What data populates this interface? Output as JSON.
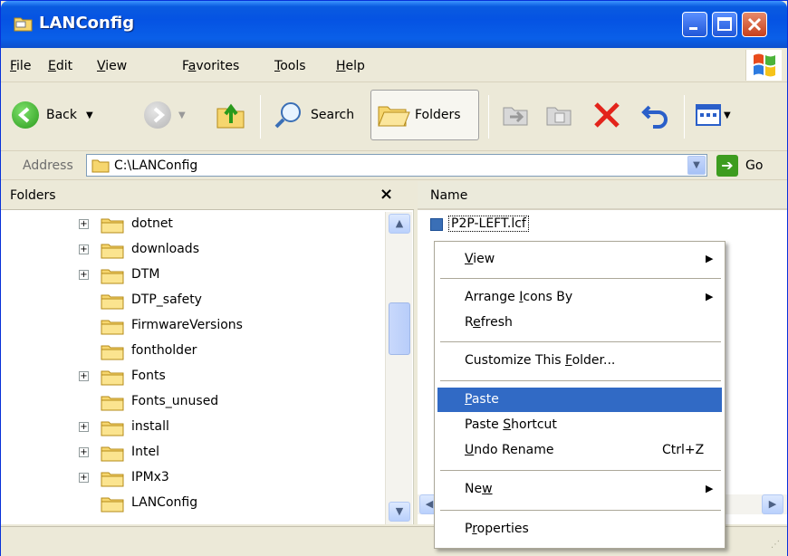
{
  "window": {
    "title": "LANConfig",
    "colors": {
      "titlebar": "#0553e3",
      "menu_highlight": "#316ac5"
    }
  },
  "menubar": {
    "items": [
      {
        "pre": "",
        "key": "F",
        "post": "ile"
      },
      {
        "pre": "",
        "key": "E",
        "post": "dit"
      },
      {
        "pre": "",
        "key": "V",
        "post": "iew"
      },
      {
        "pre": "F",
        "key": "a",
        "post": "vorites"
      },
      {
        "pre": "",
        "key": "T",
        "post": "ools"
      },
      {
        "pre": "",
        "key": "H",
        "post": "elp"
      }
    ]
  },
  "toolbar": {
    "back_label": "Back",
    "search_label": "Search",
    "folders_label": "Folders",
    "icons": [
      "back-icon",
      "forward-icon",
      "up-folder-icon",
      "search-icon",
      "folders-icon",
      "move-to-icon",
      "copy-to-icon",
      "delete-icon",
      "undo-icon",
      "views-icon"
    ]
  },
  "address": {
    "label": "Address",
    "path": "C:\\LANConfig",
    "go_label": "Go"
  },
  "folders": {
    "title": "Folders",
    "close": "×",
    "items": [
      {
        "name": "dotnet",
        "expandable": true
      },
      {
        "name": "downloads",
        "expandable": true
      },
      {
        "name": "DTM",
        "expandable": true
      },
      {
        "name": "DTP_safety",
        "expandable": false
      },
      {
        "name": "FirmwareVersions",
        "expandable": false
      },
      {
        "name": "fontholder",
        "expandable": false
      },
      {
        "name": "Fonts",
        "expandable": true
      },
      {
        "name": "Fonts_unused",
        "expandable": false
      },
      {
        "name": "install",
        "expandable": true
      },
      {
        "name": "Intel",
        "expandable": true
      },
      {
        "name": "IPMx3",
        "expandable": true
      },
      {
        "name": "LANConfig",
        "expandable": false
      }
    ]
  },
  "files": {
    "column_name": "Name",
    "items": [
      {
        "name": "P2P-LEFT.lcf"
      }
    ]
  },
  "context_menu": {
    "items": [
      {
        "pre": "",
        "key": "V",
        "post": "iew",
        "submenu": true,
        "shortcut": ""
      },
      {
        "pre": "Arrange ",
        "key": "I",
        "post": "cons By",
        "submenu": true,
        "shortcut": ""
      },
      {
        "pre": "R",
        "key": "e",
        "post": "fresh",
        "submenu": false,
        "shortcut": ""
      },
      {
        "pre": "Customize This ",
        "key": "F",
        "post": "older...",
        "submenu": false,
        "shortcut": ""
      },
      {
        "pre": "",
        "key": "P",
        "post": "aste",
        "submenu": false,
        "shortcut": "",
        "highlighted": true
      },
      {
        "pre": "Paste ",
        "key": "S",
        "post": "hortcut",
        "submenu": false,
        "shortcut": ""
      },
      {
        "pre": "",
        "key": "U",
        "post": "ndo Rename",
        "submenu": false,
        "shortcut": "Ctrl+Z"
      },
      {
        "pre": "Ne",
        "key": "w",
        "post": "",
        "submenu": true,
        "shortcut": ""
      },
      {
        "pre": "P",
        "key": "r",
        "post": "operties",
        "submenu": false,
        "shortcut": ""
      }
    ]
  }
}
